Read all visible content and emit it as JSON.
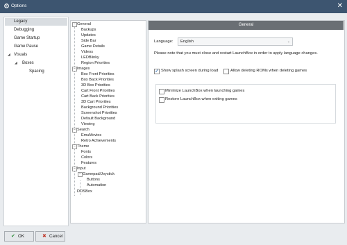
{
  "window": {
    "title": "Options",
    "close_glyph": "✕"
  },
  "left_nav": {
    "items": [
      {
        "label": "Legacy",
        "selected": true
      },
      {
        "label": "Debugging"
      },
      {
        "label": "Game Startup"
      },
      {
        "label": "Game Pause"
      },
      {
        "label": "Visuals",
        "expanded": true
      },
      {
        "label": "Boxes",
        "expanded": true
      },
      {
        "label": "Spacing"
      }
    ]
  },
  "tree": {
    "items": [
      {
        "label": "General",
        "kind": "parent"
      },
      {
        "label": "Backups"
      },
      {
        "label": "Updates"
      },
      {
        "label": "Side Bar"
      },
      {
        "label": "Game Details"
      },
      {
        "label": "Videos"
      },
      {
        "label": "LEDBlinky"
      },
      {
        "label": "Region Priorities"
      },
      {
        "label": "Images",
        "kind": "parent"
      },
      {
        "label": "Box Front Priorities"
      },
      {
        "label": "Box Back Priorities"
      },
      {
        "label": "3D Box Priorities"
      },
      {
        "label": "Cart Front Priorities"
      },
      {
        "label": "Cart Back Priorities"
      },
      {
        "label": "3D Cart Priorities"
      },
      {
        "label": "Background Priorities"
      },
      {
        "label": "Screenshot Priorities"
      },
      {
        "label": "Default Background"
      },
      {
        "label": "Viewing"
      },
      {
        "label": "Search",
        "kind": "parent"
      },
      {
        "label": "EmuMovies"
      },
      {
        "label": "Retro Achievements"
      },
      {
        "label": "Theme",
        "kind": "parent"
      },
      {
        "label": "Fonts"
      },
      {
        "label": "Colors"
      },
      {
        "label": "Features"
      },
      {
        "label": "Input",
        "kind": "parent"
      },
      {
        "label": "Gamepad/Joystick",
        "kind": "parent"
      },
      {
        "label": "Buttons"
      },
      {
        "label": "Automation"
      },
      {
        "label": "DOSBox"
      }
    ],
    "expand_glyph": "−"
  },
  "content": {
    "header": "General",
    "language_label": "Language:",
    "language_value": "English",
    "dropdown_glyph": "⌄",
    "notice": "Please note that you must close and restart LaunchBox in order to apply language changes.",
    "checkboxes": {
      "splash": {
        "label": "Show splash screen during load",
        "checked": true
      },
      "allow_delete_roms": {
        "label": "Allow deleting ROMs when deleting games",
        "checked": false
      },
      "minimize": {
        "label": "Minimize LaunchBox when launching games",
        "checked": false
      },
      "restore": {
        "label": "Restore LaunchBox when exiting games",
        "checked": false
      }
    },
    "check_glyph": "✓"
  },
  "footer": {
    "ok_label": "OK",
    "cancel_label": "Cancel",
    "ok_icon_glyph": "✔",
    "cancel_icon_glyph": "✖"
  },
  "colors": {
    "titlebar": "#3d5570",
    "section_header": "#6a6f74",
    "accent_check": "#1a5fa8"
  }
}
